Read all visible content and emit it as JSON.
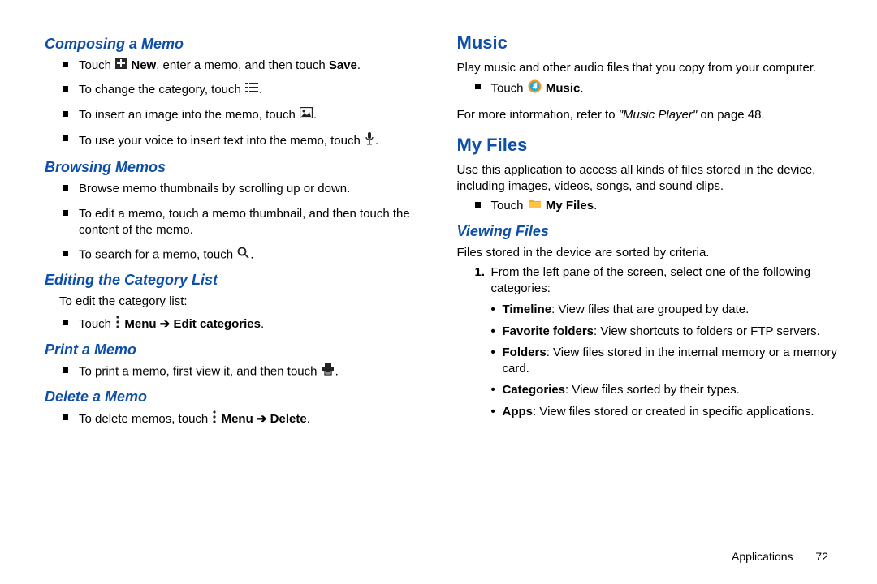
{
  "left": {
    "composing": {
      "heading": "Composing a Memo",
      "i1a": "Touch ",
      "i1b": " New",
      "i1c": ", enter a memo, and then touch ",
      "i1d": "Save",
      "i1e": ".",
      "i2a": "To change the category, touch ",
      "i2b": ".",
      "i3a": "To insert an image into the memo, touch ",
      "i3b": ".",
      "i4a": "To use your voice to insert text into the memo, touch ",
      "i4b": "."
    },
    "browsing": {
      "heading": "Browsing Memos",
      "i1": "Browse memo thumbnails by scrolling up or down.",
      "i2": "To edit a memo, touch a memo thumbnail, and then touch the content of the memo.",
      "i3a": "To search for a memo, touch ",
      "i3b": "."
    },
    "editing": {
      "heading": "Editing the Category List",
      "intro": "To edit the category list:",
      "i1a": "Touch ",
      "i1b": " Menu ",
      "arrow": "➔",
      "i1c": " Edit categories",
      "i1d": "."
    },
    "print": {
      "heading": "Print a Memo",
      "i1a": "To print a memo, first view it, and then touch ",
      "i1b": "."
    },
    "delete": {
      "heading": "Delete a Memo",
      "i1a": "To delete memos, touch ",
      "i1b": " Menu ",
      "arrow": "➔",
      "i1c": " Delete",
      "i1d": "."
    }
  },
  "right": {
    "music": {
      "heading": "Music",
      "p1": "Play music and other audio files that you copy from your computer.",
      "i1a": "Touch ",
      "i1b": " Music",
      "i1c": ".",
      "p2a": "For more information, refer to ",
      "p2b": "\"Music Player\"",
      "p2c": " on page 48."
    },
    "myfiles": {
      "heading": "My Files",
      "p1": "Use this application to access all kinds of files stored in the device, including images, videos, songs, and sound clips.",
      "i1a": "Touch ",
      "i1b": " My Files",
      "i1c": "."
    },
    "viewing": {
      "heading": "Viewing Files",
      "p1": "Files stored in the device are sorted by criteria.",
      "ol1num": "1.",
      "ol1": "From the left pane of the screen, select one of the following categories:",
      "b1a": "Timeline",
      "b1b": ": View files that are grouped by date.",
      "b2a": "Favorite folders",
      "b2b": ": View shortcuts to folders or FTP servers.",
      "b3a": "Folders",
      "b3b": ": View files stored in the internal memory or a memory card.",
      "b4a": "Categories",
      "b4b": ": View files sorted by their types.",
      "b5a": "Apps",
      "b5b": ": View files stored or created in specific applications."
    }
  },
  "footer": {
    "section": "Applications",
    "page": "72"
  }
}
